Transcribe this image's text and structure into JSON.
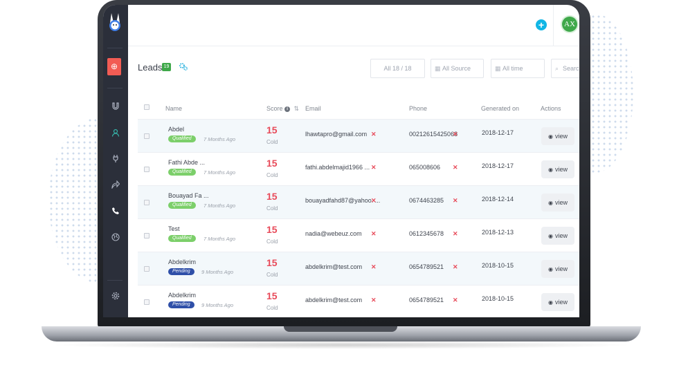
{
  "header": {
    "plus_label": "+",
    "avatar_initials": "AX"
  },
  "sidebar": {
    "add_label": "⊕"
  },
  "toolbar": {
    "title": "Leads",
    "count": "19",
    "filters": {
      "all": "All 18 / 18",
      "source": "All Source",
      "time": "All time",
      "search": "Search"
    }
  },
  "table": {
    "columns": {
      "name": "Name",
      "score": "Score",
      "email": "Email",
      "phone": "Phone",
      "generated": "Generated on",
      "actions": "Actions"
    },
    "rows": [
      {
        "name": "Abdel",
        "status": "Qualified",
        "ago": "7 Months Ago",
        "score": "15",
        "temp": "Cold",
        "email": "lhawtapro@gmail.com",
        "phone": "00212615425068",
        "date": "2018-12-17",
        "action": "view"
      },
      {
        "name": "Fathi Abde ...",
        "status": "Qualified",
        "ago": "7 Months Ago",
        "score": "15",
        "temp": "Cold",
        "email": "fathi.abdelmajid1966 ...",
        "phone": "065008606",
        "date": "2018-12-17",
        "action": "view"
      },
      {
        "name": "Bouayad Fa ...",
        "status": "Qualified",
        "ago": "7 Months Ago",
        "score": "15",
        "temp": "Cold",
        "email": "bouayadfahd87@yahoo. ...",
        "phone": "0674463285",
        "date": "2018-12-14",
        "action": "view"
      },
      {
        "name": "Test",
        "status": "Qualified",
        "ago": "7 Months Ago",
        "score": "15",
        "temp": "Cold",
        "email": "nadia@webeuz.com",
        "phone": "0612345678",
        "date": "2018-12-13",
        "action": "view"
      },
      {
        "name": "Abdelkrim",
        "status": "Pending",
        "ago": "9 Months Ago",
        "score": "15",
        "temp": "Cold",
        "email": "abdelkrim@test.com",
        "phone": "0654789521",
        "date": "2018-10-15",
        "action": "view"
      },
      {
        "name": "Abdelkrim",
        "status": "Pending",
        "ago": "9 Months Ago",
        "score": "15",
        "temp": "Cold",
        "email": "abdelkrim@test.com",
        "phone": "0654789521",
        "date": "2018-10-15",
        "action": "view"
      }
    ]
  },
  "colors": {
    "accent": "#11b6e5",
    "danger": "#e84b5a",
    "qualified": "#7ccf6a",
    "pending": "#2f4fa8",
    "sidebar": "#2b2f3a"
  }
}
